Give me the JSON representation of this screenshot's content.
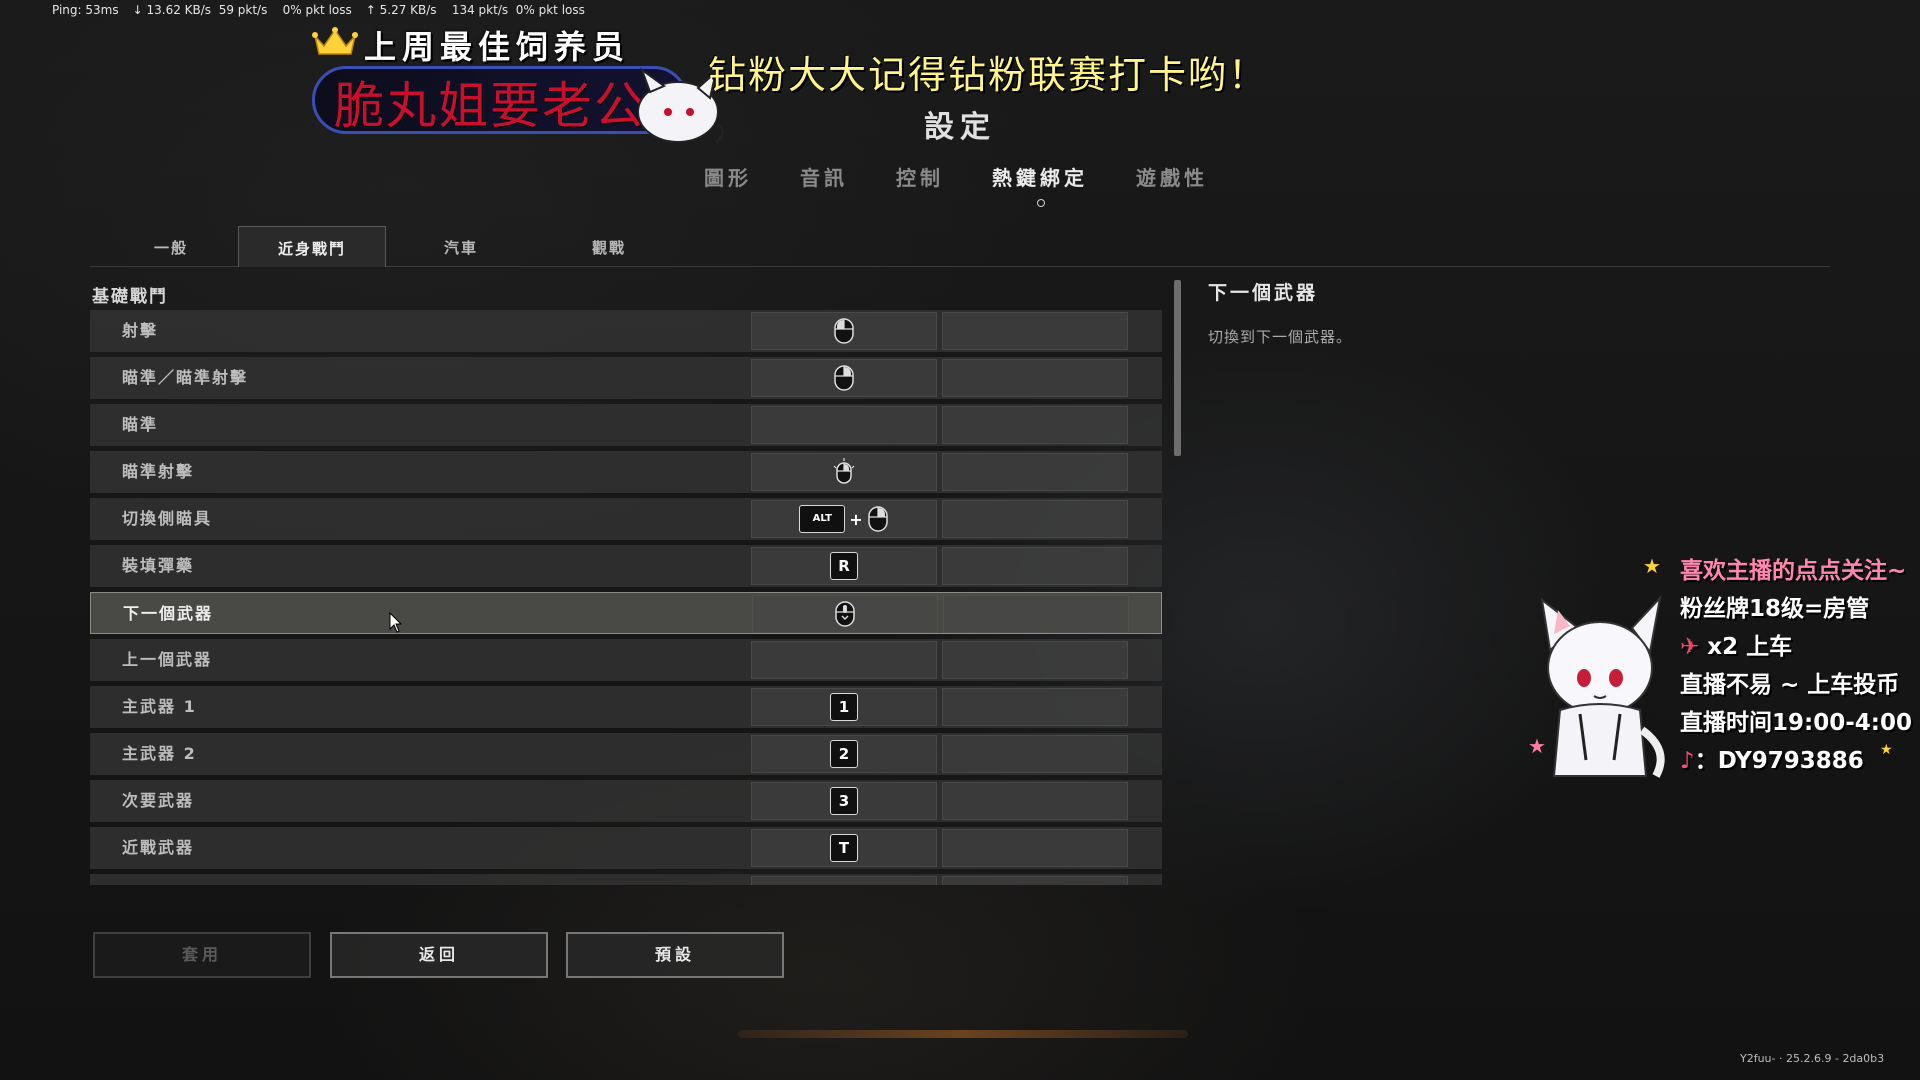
{
  "netstat": {
    "ping": "Ping: 53ms",
    "down_rate": "13.62 KB/s",
    "down_pkts": "59 pkt/s",
    "down_loss": "0% pkt loss",
    "up_rate": "5.27 KB/s",
    "up_pkts": "134 pkt/s",
    "up_loss": "0% pkt loss"
  },
  "overlay": {
    "best_feeder": "上周最佳饲养员",
    "name_plate": "脆丸姐要老公",
    "promo": "钻粉大大记得钻粉联赛打卡哟！"
  },
  "settings": {
    "title": "設定",
    "main_tabs": [
      {
        "label": "圖形"
      },
      {
        "label": "音訊"
      },
      {
        "label": "控制"
      },
      {
        "label": "熱鍵綁定",
        "active": true
      },
      {
        "label": "遊戲性"
      }
    ],
    "sub_tabs": [
      {
        "label": "一般"
      },
      {
        "label": "近身戰鬥",
        "active": true
      },
      {
        "label": "汽車"
      },
      {
        "label": "觀戰"
      }
    ],
    "section": "基礎戰鬥",
    "bindings": [
      {
        "label": "射擊",
        "primary_icon": "mouse-left-icon"
      },
      {
        "label": "瞄準／瞄準射擊",
        "primary_icon": "mouse-right-icon"
      },
      {
        "label": "瞄準"
      },
      {
        "label": "瞄準射擊",
        "primary_icon": "mouse-right-click-icon"
      },
      {
        "label": "切換側瞄具",
        "primary_key": "ALT",
        "primary_icon": "mouse-right-icon"
      },
      {
        "label": "裝填彈藥",
        "primary_key": "R"
      },
      {
        "label": "下一個武器",
        "primary_icon": "mouse-wheel-down-icon",
        "selected": true
      },
      {
        "label": "上一個武器"
      },
      {
        "label": "主武器 1",
        "primary_key": "1"
      },
      {
        "label": "主武器 2",
        "primary_key": "2"
      },
      {
        "label": "次要武器",
        "primary_key": "3"
      },
      {
        "label": "近戰武器",
        "primary_key": "T"
      }
    ],
    "plus_sign": "+",
    "description": {
      "title": "下一個武器",
      "body": "切換到下一個武器。"
    },
    "buttons": {
      "apply": "套用",
      "back": "返回",
      "defaults": "預設"
    }
  },
  "stream": {
    "line1": "喜欢主播的点点关注~",
    "line2": "粉丝牌18级=房管",
    "line3": "x2 上车",
    "line4": "直播不易 ~ 上车投币",
    "line5": "直播时间19:00-4:00",
    "line6": "：DY9793886"
  },
  "version": "Y2fuu- · 25.2.6.9 - 2da0b3",
  "colors": {
    "promo_yellow": "#fff38a",
    "name_red": "#c8102e",
    "stream_pink": "#ff86b0",
    "plate_border": "#3a4fb5"
  }
}
